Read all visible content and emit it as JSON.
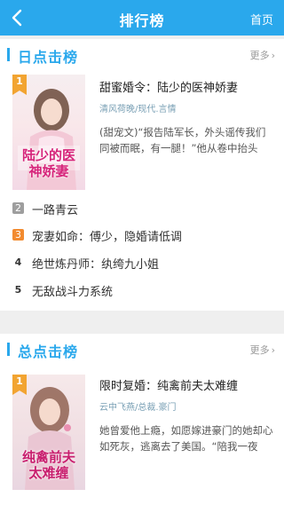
{
  "header": {
    "title": "排行榜",
    "home_label": "首页"
  },
  "sections": [
    {
      "name": "日点击榜",
      "more_label": "更多",
      "top_book": {
        "rank": "1",
        "title": "甜蜜婚令：陆少的医神娇妻",
        "meta": "清风荷晚/现代.言情",
        "desc": "(甜宠文)“报告陆军长，外头谣传我们同被而眠，有一腿！”他从卷中抬头",
        "cover_text": "陆少的医神娇妻"
      },
      "list": [
        {
          "rank": "2",
          "title": "一路青云"
        },
        {
          "rank": "3",
          "title": "宠妻如命：傅少，隐婚请低调"
        },
        {
          "rank": "4",
          "title": "绝世炼丹师：纨绔九小姐"
        },
        {
          "rank": "5",
          "title": "无敌战斗力系统"
        }
      ]
    },
    {
      "name": "总点击榜",
      "more_label": "更多",
      "top_book": {
        "rank": "1",
        "title": "限时复婚：纯禽前夫太难缠",
        "meta": "云中飞燕/总裁.豪门",
        "desc": "她曾爱他上瘾，如愿嫁进豪门的她却心如死灰，逃离去了美国。“陪我一夜",
        "cover_text": "纯禽前夫太难缠"
      }
    }
  ],
  "colors": {
    "accent": "#2aa8ec",
    "rank2": "#9e9e9e",
    "rank3": "#f28b30",
    "rank1": "#f2a431"
  }
}
